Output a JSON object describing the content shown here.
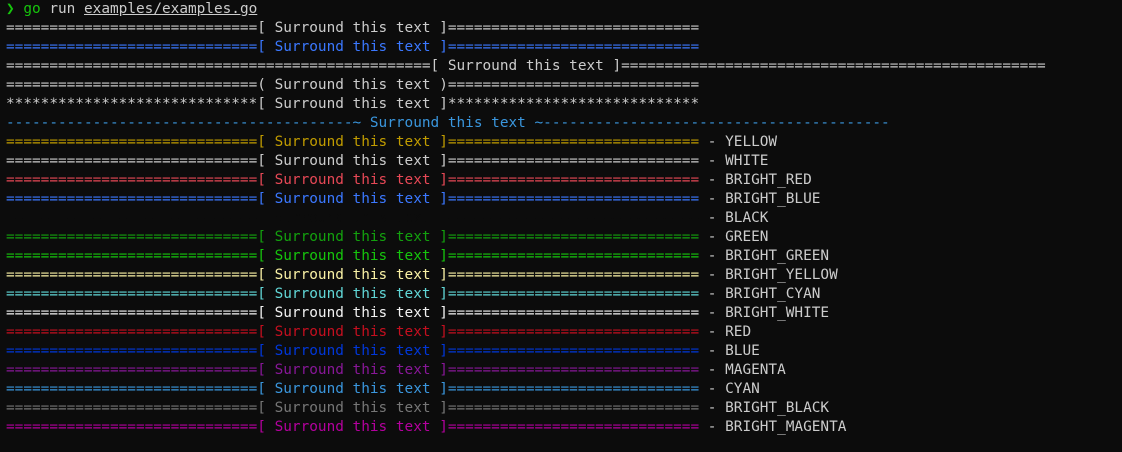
{
  "prompt": {
    "arrow": "❯",
    "command": "go",
    "subcommand": "run",
    "arg": "examples/examples.go"
  },
  "colors": {
    "default": "#cccccc",
    "blue_header": "#3b78ff",
    "cyan_wave": "#3a96dd",
    "YELLOW": "#c19c00",
    "WHITE": "#cccccc",
    "BRIGHT_RED": "#e74856",
    "BRIGHT_BLUE": "#3b78ff",
    "BLACK": "#0c0c0c",
    "GREEN": "#13a10e",
    "BRIGHT_GREEN": "#16c60c",
    "BRIGHT_YELLOW": "#f9f1a5",
    "BRIGHT_CYAN": "#61d6d6",
    "BRIGHT_WHITE": "#f2f2f2",
    "RED": "#c50f1f",
    "BLUE": "#0037da",
    "MAGENTA": "#881798",
    "CYAN": "#3a96dd",
    "BRIGHT_BLACK": "#767676",
    "BRIGHT_MAGENTA": "#b4009e"
  },
  "lines": [
    {
      "text": "=============================[ Surround this text ]=============================",
      "color": "default"
    },
    {
      "text": "=============================[ Surround this text ]=============================",
      "color": "blue_header"
    },
    {
      "text": "=================================================[ Surround this text ]=================================================",
      "color": "default"
    },
    {
      "text": "=============================( Surround this text )=============================",
      "color": "default"
    },
    {
      "text": "*****************************[ Surround this text ]*****************************",
      "color": "default"
    },
    {
      "text": "----------------------------------------~ Surround this text ~----------------------------------------",
      "color": "cyan_wave"
    }
  ],
  "color_lines": [
    {
      "text": "=============================[ Surround this text ]=============================",
      "label": " - YELLOW",
      "color": "YELLOW"
    },
    {
      "text": "=============================[ Surround this text ]=============================",
      "label": " - WHITE",
      "color": "WHITE"
    },
    {
      "text": "=============================[ Surround this text ]=============================",
      "label": " - BRIGHT_RED",
      "color": "BRIGHT_RED"
    },
    {
      "text": "=============================[ Surround this text ]=============================",
      "label": " - BRIGHT_BLUE",
      "color": "BRIGHT_BLUE"
    },
    {
      "text": "=============================[ Surround this text ]=============================",
      "label": " - BLACK",
      "color": "BLACK"
    },
    {
      "text": "=============================[ Surround this text ]=============================",
      "label": " - GREEN",
      "color": "GREEN"
    },
    {
      "text": "=============================[ Surround this text ]=============================",
      "label": " - BRIGHT_GREEN",
      "color": "BRIGHT_GREEN"
    },
    {
      "text": "=============================[ Surround this text ]=============================",
      "label": " - BRIGHT_YELLOW",
      "color": "BRIGHT_YELLOW"
    },
    {
      "text": "=============================[ Surround this text ]=============================",
      "label": " - BRIGHT_CYAN",
      "color": "BRIGHT_CYAN"
    },
    {
      "text": "=============================[ Surround this text ]=============================",
      "label": " - BRIGHT_WHITE",
      "color": "BRIGHT_WHITE"
    },
    {
      "text": "=============================[ Surround this text ]=============================",
      "label": " - RED",
      "color": "RED"
    },
    {
      "text": "=============================[ Surround this text ]=============================",
      "label": " - BLUE",
      "color": "BLUE"
    },
    {
      "text": "=============================[ Surround this text ]=============================",
      "label": " - MAGENTA",
      "color": "MAGENTA"
    },
    {
      "text": "=============================[ Surround this text ]=============================",
      "label": " - CYAN",
      "color": "CYAN"
    },
    {
      "text": "=============================[ Surround this text ]=============================",
      "label": " - BRIGHT_BLACK",
      "color": "BRIGHT_BLACK"
    },
    {
      "text": "=============================[ Surround this text ]=============================",
      "label": " - BRIGHT_MAGENTA",
      "color": "BRIGHT_MAGENTA"
    }
  ]
}
